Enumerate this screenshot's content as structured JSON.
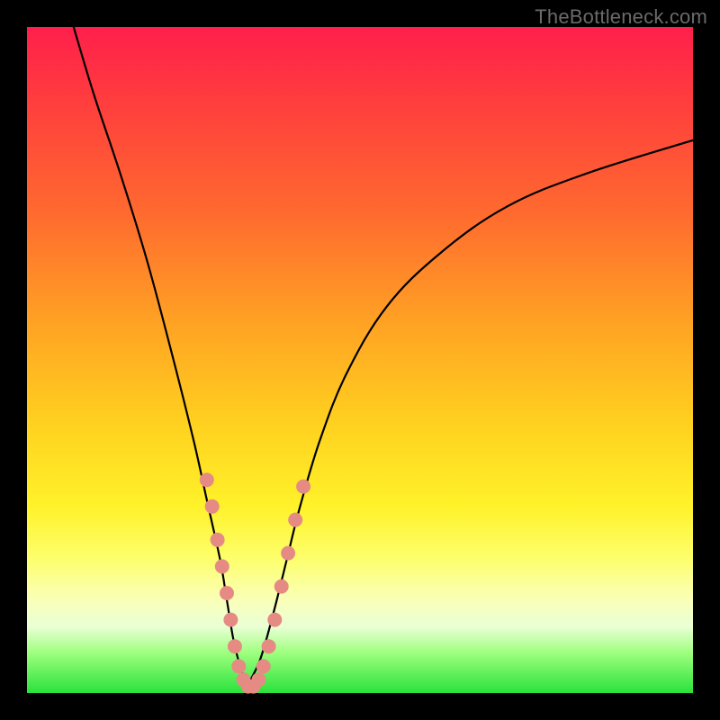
{
  "watermark": "TheBottleneck.com",
  "chart_data": {
    "type": "line",
    "title": "",
    "xlabel": "",
    "ylabel": "",
    "xlim": [
      0,
      100
    ],
    "ylim": [
      0,
      100
    ],
    "legend": false,
    "grid": false,
    "gradient_stops": [
      {
        "pct": 0,
        "color": "#ff1f4b"
      },
      {
        "pct": 10,
        "color": "#ff3a3f"
      },
      {
        "pct": 28,
        "color": "#ff6a2f"
      },
      {
        "pct": 45,
        "color": "#ffa423"
      },
      {
        "pct": 60,
        "color": "#ffd21f"
      },
      {
        "pct": 72,
        "color": "#fff22a"
      },
      {
        "pct": 80,
        "color": "#fdff6e"
      },
      {
        "pct": 86,
        "color": "#faffb8"
      },
      {
        "pct": 90,
        "color": "#eaffd5"
      },
      {
        "pct": 94,
        "color": "#9dff7e"
      },
      {
        "pct": 100,
        "color": "#29e23b"
      }
    ],
    "series": [
      {
        "name": "left-branch",
        "x": [
          7,
          10,
          14,
          18,
          22,
          25,
          27,
          29,
          30,
          31,
          32,
          33
        ],
        "y": [
          100,
          90,
          78,
          65,
          50,
          38,
          29,
          20,
          14,
          8,
          4,
          1
        ]
      },
      {
        "name": "right-branch",
        "x": [
          33,
          35,
          37,
          39,
          41,
          44,
          48,
          54,
          62,
          72,
          84,
          100
        ],
        "y": [
          1,
          5,
          12,
          20,
          28,
          38,
          48,
          58,
          66,
          73,
          78,
          83
        ]
      }
    ],
    "markers": {
      "name": "highlight-beads",
      "color": "#e58b84",
      "points": [
        {
          "x": 27.0,
          "y": 32
        },
        {
          "x": 27.8,
          "y": 28
        },
        {
          "x": 28.6,
          "y": 23
        },
        {
          "x": 29.3,
          "y": 19
        },
        {
          "x": 30.0,
          "y": 15
        },
        {
          "x": 30.6,
          "y": 11
        },
        {
          "x": 31.2,
          "y": 7
        },
        {
          "x": 31.8,
          "y": 4
        },
        {
          "x": 32.5,
          "y": 2
        },
        {
          "x": 33.2,
          "y": 1
        },
        {
          "x": 34.0,
          "y": 1
        },
        {
          "x": 34.8,
          "y": 2
        },
        {
          "x": 35.5,
          "y": 4
        },
        {
          "x": 36.3,
          "y": 7
        },
        {
          "x": 37.2,
          "y": 11
        },
        {
          "x": 38.2,
          "y": 16
        },
        {
          "x": 39.2,
          "y": 21
        },
        {
          "x": 40.3,
          "y": 26
        },
        {
          "x": 41.5,
          "y": 31
        }
      ]
    },
    "minimum": {
      "x": 33,
      "y": 0
    }
  }
}
